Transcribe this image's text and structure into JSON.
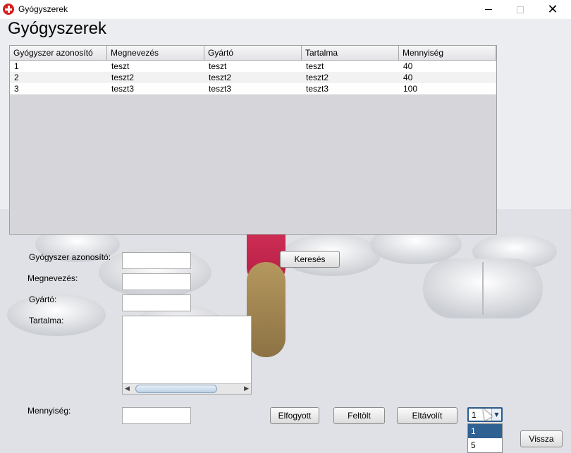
{
  "window": {
    "title": "Gyógyszerek"
  },
  "page": {
    "heading": "Gyógyszerek"
  },
  "table": {
    "columns": [
      "Gyógyszer azonosító",
      "Megnevezés",
      "Gyártó",
      "Tartalma",
      "Mennyiség"
    ],
    "rows": [
      [
        "1",
        "teszt",
        "teszt",
        "teszt",
        "40"
      ],
      [
        "2",
        "teszt2",
        "teszt2",
        "teszt2",
        "40"
      ],
      [
        "3",
        "teszt3",
        "teszt3",
        "teszt3",
        "100"
      ]
    ]
  },
  "form": {
    "id_label": "Gyógyszer azonosító:",
    "id_value": "",
    "name_label": "Megnevezés:",
    "name_value": "",
    "maker_label": "Gyártó:",
    "maker_value": "",
    "content_label": "Tartalma:",
    "content_value": "",
    "quantity_label": "Mennyiség:",
    "quantity_value": ""
  },
  "buttons": {
    "search": "Keresés",
    "sold_out": "Elfogyott",
    "upload": "Feltölt",
    "remove": "Eltávolít",
    "back": "Vissza"
  },
  "combo": {
    "selected": "1",
    "options": [
      "1",
      "5"
    ]
  },
  "colors": {
    "icon_red": "#d81e1e",
    "selection_blue": "#2f6193"
  },
  "icons": {
    "app": "red-cross-icon",
    "minimize": "minimize-icon",
    "maximize": "maximize-icon",
    "close": "close-icon"
  }
}
